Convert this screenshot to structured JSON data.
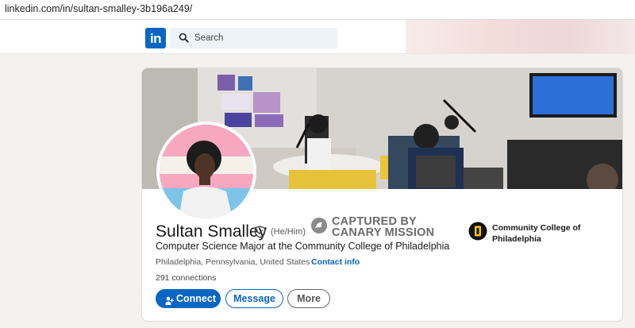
{
  "browser": {
    "url": "linkedin.com/in/sultan-smalley-3b196a249/"
  },
  "header": {
    "logo_text": "in",
    "search_placeholder": "Search"
  },
  "profile": {
    "name": "Sultan Smalley",
    "pronouns": "(He/Him)",
    "headline": "Computer Science Major at the Community College of Philadelphia",
    "location": "Philadelphia, Pennsylvania, United States",
    "location_separator": "·",
    "contact_info_label": "Contact info",
    "connections": "291 connections",
    "school": "Community College of Philadelphia"
  },
  "watermark": {
    "line1": "CAPTURED BY",
    "line2": "CANARY MISSION"
  },
  "actions": {
    "connect_label": "Connect",
    "message_label": "Message",
    "more_label": "More"
  },
  "colors": {
    "linkedin_blue": "#0a66c2",
    "page_background": "#f4f2ee",
    "school_logo": "#f2c500"
  }
}
